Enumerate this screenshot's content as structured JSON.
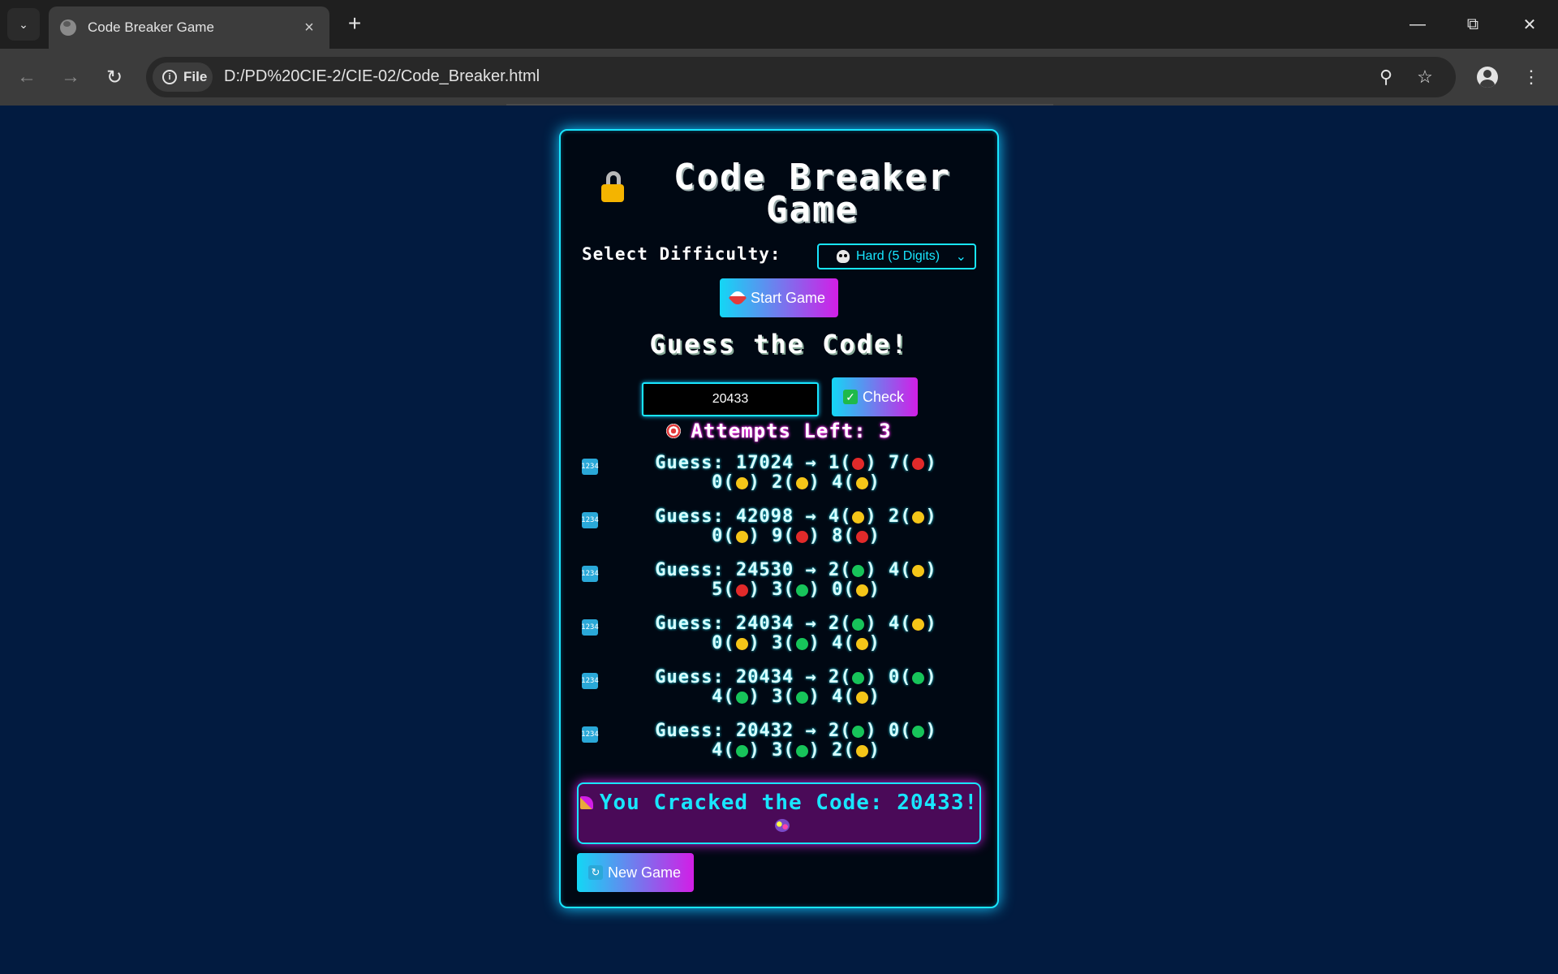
{
  "browser": {
    "tab_title": "Code Breaker Game",
    "new_tab_label": "+",
    "chip_label": "File",
    "url": "D:/PD%20CIE-2/CIE-02/Code_Breaker.html"
  },
  "game": {
    "title": "Code Breaker Game",
    "difficulty_label": "Select Difficulty:",
    "difficulty_selected": "Hard (5 Digits)",
    "start_label": "Start Game",
    "guess_heading": "Guess the Code!",
    "guess_value": "20433",
    "check_label": "Check",
    "attempts_text": "Attempts Left: 3",
    "history": [
      {
        "line1": "Guess: 17024 → ",
        "line2": "",
        "digits": [
          {
            "d": "1",
            "color": "#e22a2a"
          },
          {
            "d": "7",
            "color": "#e22a2a"
          },
          {
            "d": "0",
            "color": "#f5c518"
          },
          {
            "d": "2",
            "color": "#f5c518"
          },
          {
            "d": "4",
            "color": "#f5c518"
          }
        ]
      },
      {
        "line1": "Guess: 42098 → ",
        "line2": "",
        "digits": [
          {
            "d": "4",
            "color": "#f5c518"
          },
          {
            "d": "2",
            "color": "#f5c518"
          },
          {
            "d": "0",
            "color": "#f5c518"
          },
          {
            "d": "9",
            "color": "#e22a2a"
          },
          {
            "d": "8",
            "color": "#e22a2a"
          }
        ]
      },
      {
        "line1": "Guess: 24530 → ",
        "line2": "",
        "digits": [
          {
            "d": "2",
            "color": "#17c45a"
          },
          {
            "d": "4",
            "color": "#f5c518"
          },
          {
            "d": "5",
            "color": "#e22a2a"
          },
          {
            "d": "3",
            "color": "#17c45a"
          },
          {
            "d": "0",
            "color": "#f5c518"
          }
        ]
      },
      {
        "line1": "Guess: 24034 → ",
        "line2": "",
        "digits": [
          {
            "d": "2",
            "color": "#17c45a"
          },
          {
            "d": "4",
            "color": "#f5c518"
          },
          {
            "d": "0",
            "color": "#f5c518"
          },
          {
            "d": "3",
            "color": "#17c45a"
          },
          {
            "d": "4",
            "color": "#f5c518"
          }
        ]
      },
      {
        "line1": "Guess: 20434 → ",
        "line2": "",
        "digits": [
          {
            "d": "2",
            "color": "#17c45a"
          },
          {
            "d": "0",
            "color": "#17c45a"
          },
          {
            "d": "4",
            "color": "#17c45a"
          },
          {
            "d": "3",
            "color": "#17c45a"
          },
          {
            "d": "4",
            "color": "#f5c518"
          }
        ]
      },
      {
        "line1": "Guess: 20432 → ",
        "line2": "",
        "digits": [
          {
            "d": "2",
            "color": "#17c45a"
          },
          {
            "d": "0",
            "color": "#17c45a"
          },
          {
            "d": "4",
            "color": "#17c45a"
          },
          {
            "d": "3",
            "color": "#17c45a"
          },
          {
            "d": "2",
            "color": "#f5c518"
          }
        ]
      }
    ],
    "win_message": "You Cracked the Code: 20433!",
    "new_game_label": "New Game"
  },
  "colors": {
    "page_bg": "#021b40",
    "neon_cyan": "#18e6ff",
    "neon_magenta": "#d21ee6",
    "correct": "#17c45a",
    "misplaced": "#f5c518",
    "absent": "#e22a2a"
  }
}
